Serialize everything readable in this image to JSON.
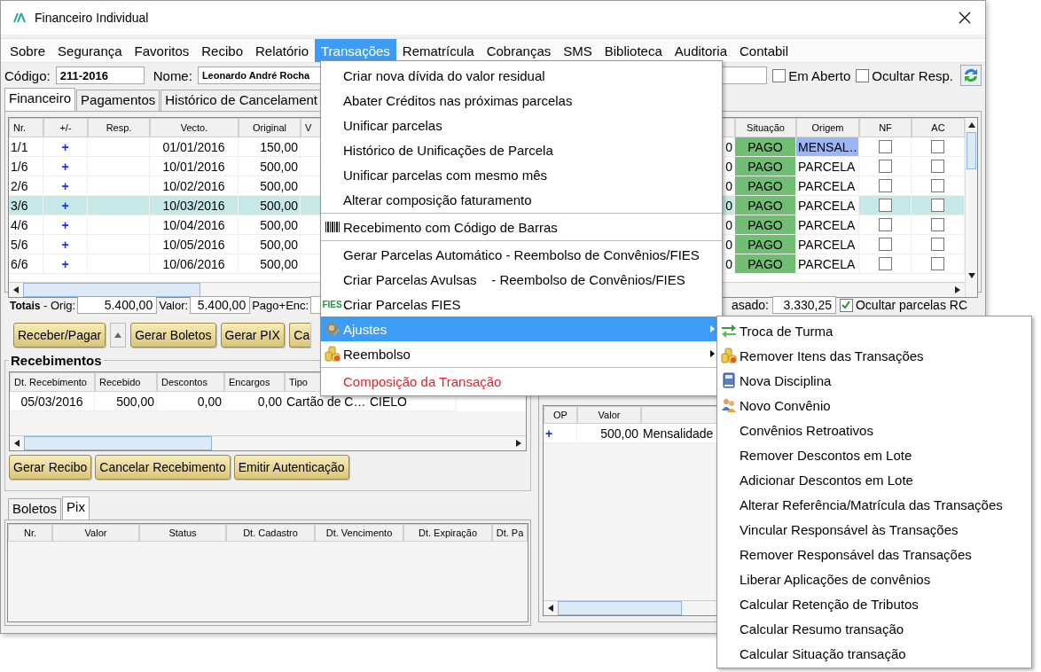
{
  "window": {
    "title": "Financeiro Individual"
  },
  "menu_bar": [
    {
      "label": "Sobre",
      "selected": false
    },
    {
      "label": "Segurança",
      "selected": false
    },
    {
      "label": "Favoritos",
      "selected": false
    },
    {
      "label": "Recibo",
      "selected": false
    },
    {
      "label": "Relatório",
      "selected": false
    },
    {
      "label": "Transações",
      "selected": true
    },
    {
      "label": "Rematrícula",
      "selected": false
    },
    {
      "label": "Cobranças",
      "selected": false
    },
    {
      "label": "SMS",
      "selected": false
    },
    {
      "label": "Biblioteca",
      "selected": false
    },
    {
      "label": "Auditoria",
      "selected": false
    },
    {
      "label": "Contabil",
      "selected": false
    }
  ],
  "header": {
    "codigo_label": "Código:",
    "codigo": "211-2016",
    "nome_label": "Nome:",
    "nome": "Leonardo André Rocha",
    "checkboxes": [
      {
        "label": "Em Aberto",
        "checked": false
      },
      {
        "label": "Ocultar Resp.",
        "checked": false
      }
    ]
  },
  "tabs": [
    {
      "label": "Financeiro",
      "selected": true
    },
    {
      "label": "Pagamentos",
      "selected": false
    },
    {
      "label": "Histórico de Cancelament",
      "selected": false
    }
  ],
  "parcelas": {
    "columns": {
      "nr": "Nr.",
      "op": "+/-",
      "resp": "Resp.",
      "vecto": "Vecto.",
      "original": "Original",
      "column_6": "V",
      "situacao": "Situação",
      "origem": "Origem",
      "nf": "NF",
      "ac": "AC"
    },
    "rows": [
      {
        "nr": "1/1",
        "op": "+",
        "vecto": "01/01/2016",
        "original": "150,00",
        "column_7": "0",
        "situacao": "PAGO",
        "origem": {
          "text": "MENSAL…",
          "color": "#9bb5f5"
        },
        "nf": false,
        "ac": false,
        "selected": false
      },
      {
        "nr": "1/6",
        "op": "+",
        "vecto": "10/01/2016",
        "original": "500,00",
        "column_7": "0",
        "situacao": "PAGO",
        "origem": {
          "text": "PARCELA",
          "color": "#ffffff"
        },
        "nf": false,
        "ac": false,
        "selected": false
      },
      {
        "nr": "2/6",
        "op": "+",
        "vecto": "10/02/2016",
        "original": "500,00",
        "column_7": "0",
        "situacao": "PAGO",
        "origem": {
          "text": "PARCELA",
          "color": "#ffffff"
        },
        "nf": false,
        "ac": false,
        "selected": false
      },
      {
        "nr": "3/6",
        "op": "+",
        "vecto": "10/03/2016",
        "original": "500,00",
        "column_7": "0",
        "situacao": "PAGO",
        "origem": {
          "text": "PARCELA",
          "color": "#ffffff"
        },
        "nf": false,
        "ac": false,
        "selected": true
      },
      {
        "nr": "4/6",
        "op": "+",
        "vecto": "10/04/2016",
        "original": "500,00",
        "column_7": "0",
        "situacao": "PAGO",
        "origem": {
          "text": "PARCELA",
          "color": "#ffffff"
        },
        "nf": false,
        "ac": false,
        "selected": false
      },
      {
        "nr": "5/6",
        "op": "+",
        "vecto": "10/05/2016",
        "original": "500,00",
        "column_7": "0",
        "situacao": "PAGO",
        "origem": {
          "text": "PARCELA",
          "color": "#ffffff"
        },
        "nf": false,
        "ac": false,
        "selected": false
      },
      {
        "nr": "6/6",
        "op": "+",
        "vecto": "10/06/2016",
        "original": "500,00",
        "column_7": "0",
        "situacao": "PAGO",
        "origem": {
          "text": "PARCELA",
          "color": "#ffffff"
        },
        "nf": false,
        "ac": false,
        "selected": false
      }
    ]
  },
  "totals": {
    "label": "**Totais** - Orig:",
    "orig": "5.400,00",
    "valor_label": "Valor:",
    "valor": "5.400,00",
    "pago_label": "Pago+Enc:",
    "atrasado_label": "asado:",
    "atrasado": "3.330,25",
    "ocultar": {
      "label": "Ocultar parcelas RC",
      "checked": true
    }
  },
  "actions": [
    {
      "kind": "button",
      "label": "Receber/Pagar"
    },
    {
      "kind": "spin"
    },
    {
      "kind": "button",
      "label": "Gerar Boletos"
    },
    {
      "kind": "button",
      "label": "Gerar PIX"
    },
    {
      "kind": "partial",
      "label": "Ca"
    }
  ],
  "recebimentos": {
    "title": "Recebimentos",
    "columns": [
      "Dt. Recebimento",
      "Recebido",
      "Descontos",
      "Encargos",
      "Tipo"
    ],
    "rows": [
      [
        "05/03/2016",
        "500,00",
        "0,00",
        "0,00",
        "Cartão de C…",
        "CIELO"
      ]
    ],
    "buttons": [
      "Gerar Recibo",
      "Cancelar Recebimento",
      "Emitir Autenticação"
    ]
  },
  "bottom_tabs": [
    {
      "label": "Boletos",
      "selected": false
    },
    {
      "label": "Pix",
      "selected": true
    }
  ],
  "pix_table": {
    "columns": [
      "Nr.",
      "Valor",
      "Status",
      "Dt. Cadastro",
      "Dt. Vencimento",
      "Dt. Expiração",
      "Dt. Pa"
    ]
  },
  "right_panel": {
    "columns": [
      "OP",
      "Valor"
    ],
    "rows": [
      {
        "op": "+",
        "valor": "500,00",
        "descricao": "Mensalidade"
      }
    ]
  },
  "transacoes_menu": [
    {
      "kind": "item",
      "label": "Criar nova dívida do valor residual",
      "selected": false
    },
    {
      "kind": "item",
      "label": "Abater Créditos nas próximas parcelas",
      "selected": false
    },
    {
      "kind": "item",
      "label": "Unificar parcelas",
      "selected": false
    },
    {
      "kind": "item",
      "label": "Histórico de Unificações de Parcela",
      "selected": false
    },
    {
      "kind": "item",
      "label": "Unificar parcelas com mesmo mês",
      "selected": false
    },
    {
      "kind": "item",
      "label": "Alterar composição faturamento",
      "selected": false
    },
    {
      "kind": "separator"
    },
    {
      "kind": "item",
      "label": "Recebimento com Código de Barras",
      "selected": false
    },
    {
      "kind": "separator"
    },
    {
      "kind": "item",
      "label": "Gerar Parcelas Automático - Reembolso de Convênios/FIES",
      "selected": false
    },
    {
      "kind": "item",
      "label": "Criar Parcelas Avulsas    - Reembolso de Convênios/FIES",
      "selected": false
    },
    {
      "kind": "item",
      "badge": "FIES",
      "label": "Criar Parcelas FIES",
      "selected": false
    },
    {
      "kind": "submenu",
      "label": "Ajustes",
      "selected": true
    },
    {
      "kind": "submenu",
      "label": "Reembolso",
      "selected": false
    },
    {
      "kind": "separator"
    },
    {
      "kind": "danger",
      "label": "Composição da Transação",
      "selected": false
    }
  ],
  "ajustes_submenu": [
    {
      "label": "Troca de Turma"
    },
    {
      "label": "Remover Itens das Transações"
    },
    {
      "label": "Nova Disciplina"
    },
    {
      "label": "Novo Convênio"
    },
    {
      "label": "Convênios Retroativos"
    },
    {
      "label": "Remover Descontos em Lote"
    },
    {
      "label": "Adicionar Descontos em Lote"
    },
    {
      "label": "Alterar Referência/Matrícula das Transações"
    },
    {
      "label": "Vincular Responsável às Transações"
    },
    {
      "label": "Remover Responsável das Transações"
    },
    {
      "label": "Liberar Aplicações de convênios"
    },
    {
      "label": "Calcular Retenção de Tributos"
    },
    {
      "label": "Calcular Resumo transação"
    },
    {
      "label": "Calcular Situação transação"
    }
  ]
}
